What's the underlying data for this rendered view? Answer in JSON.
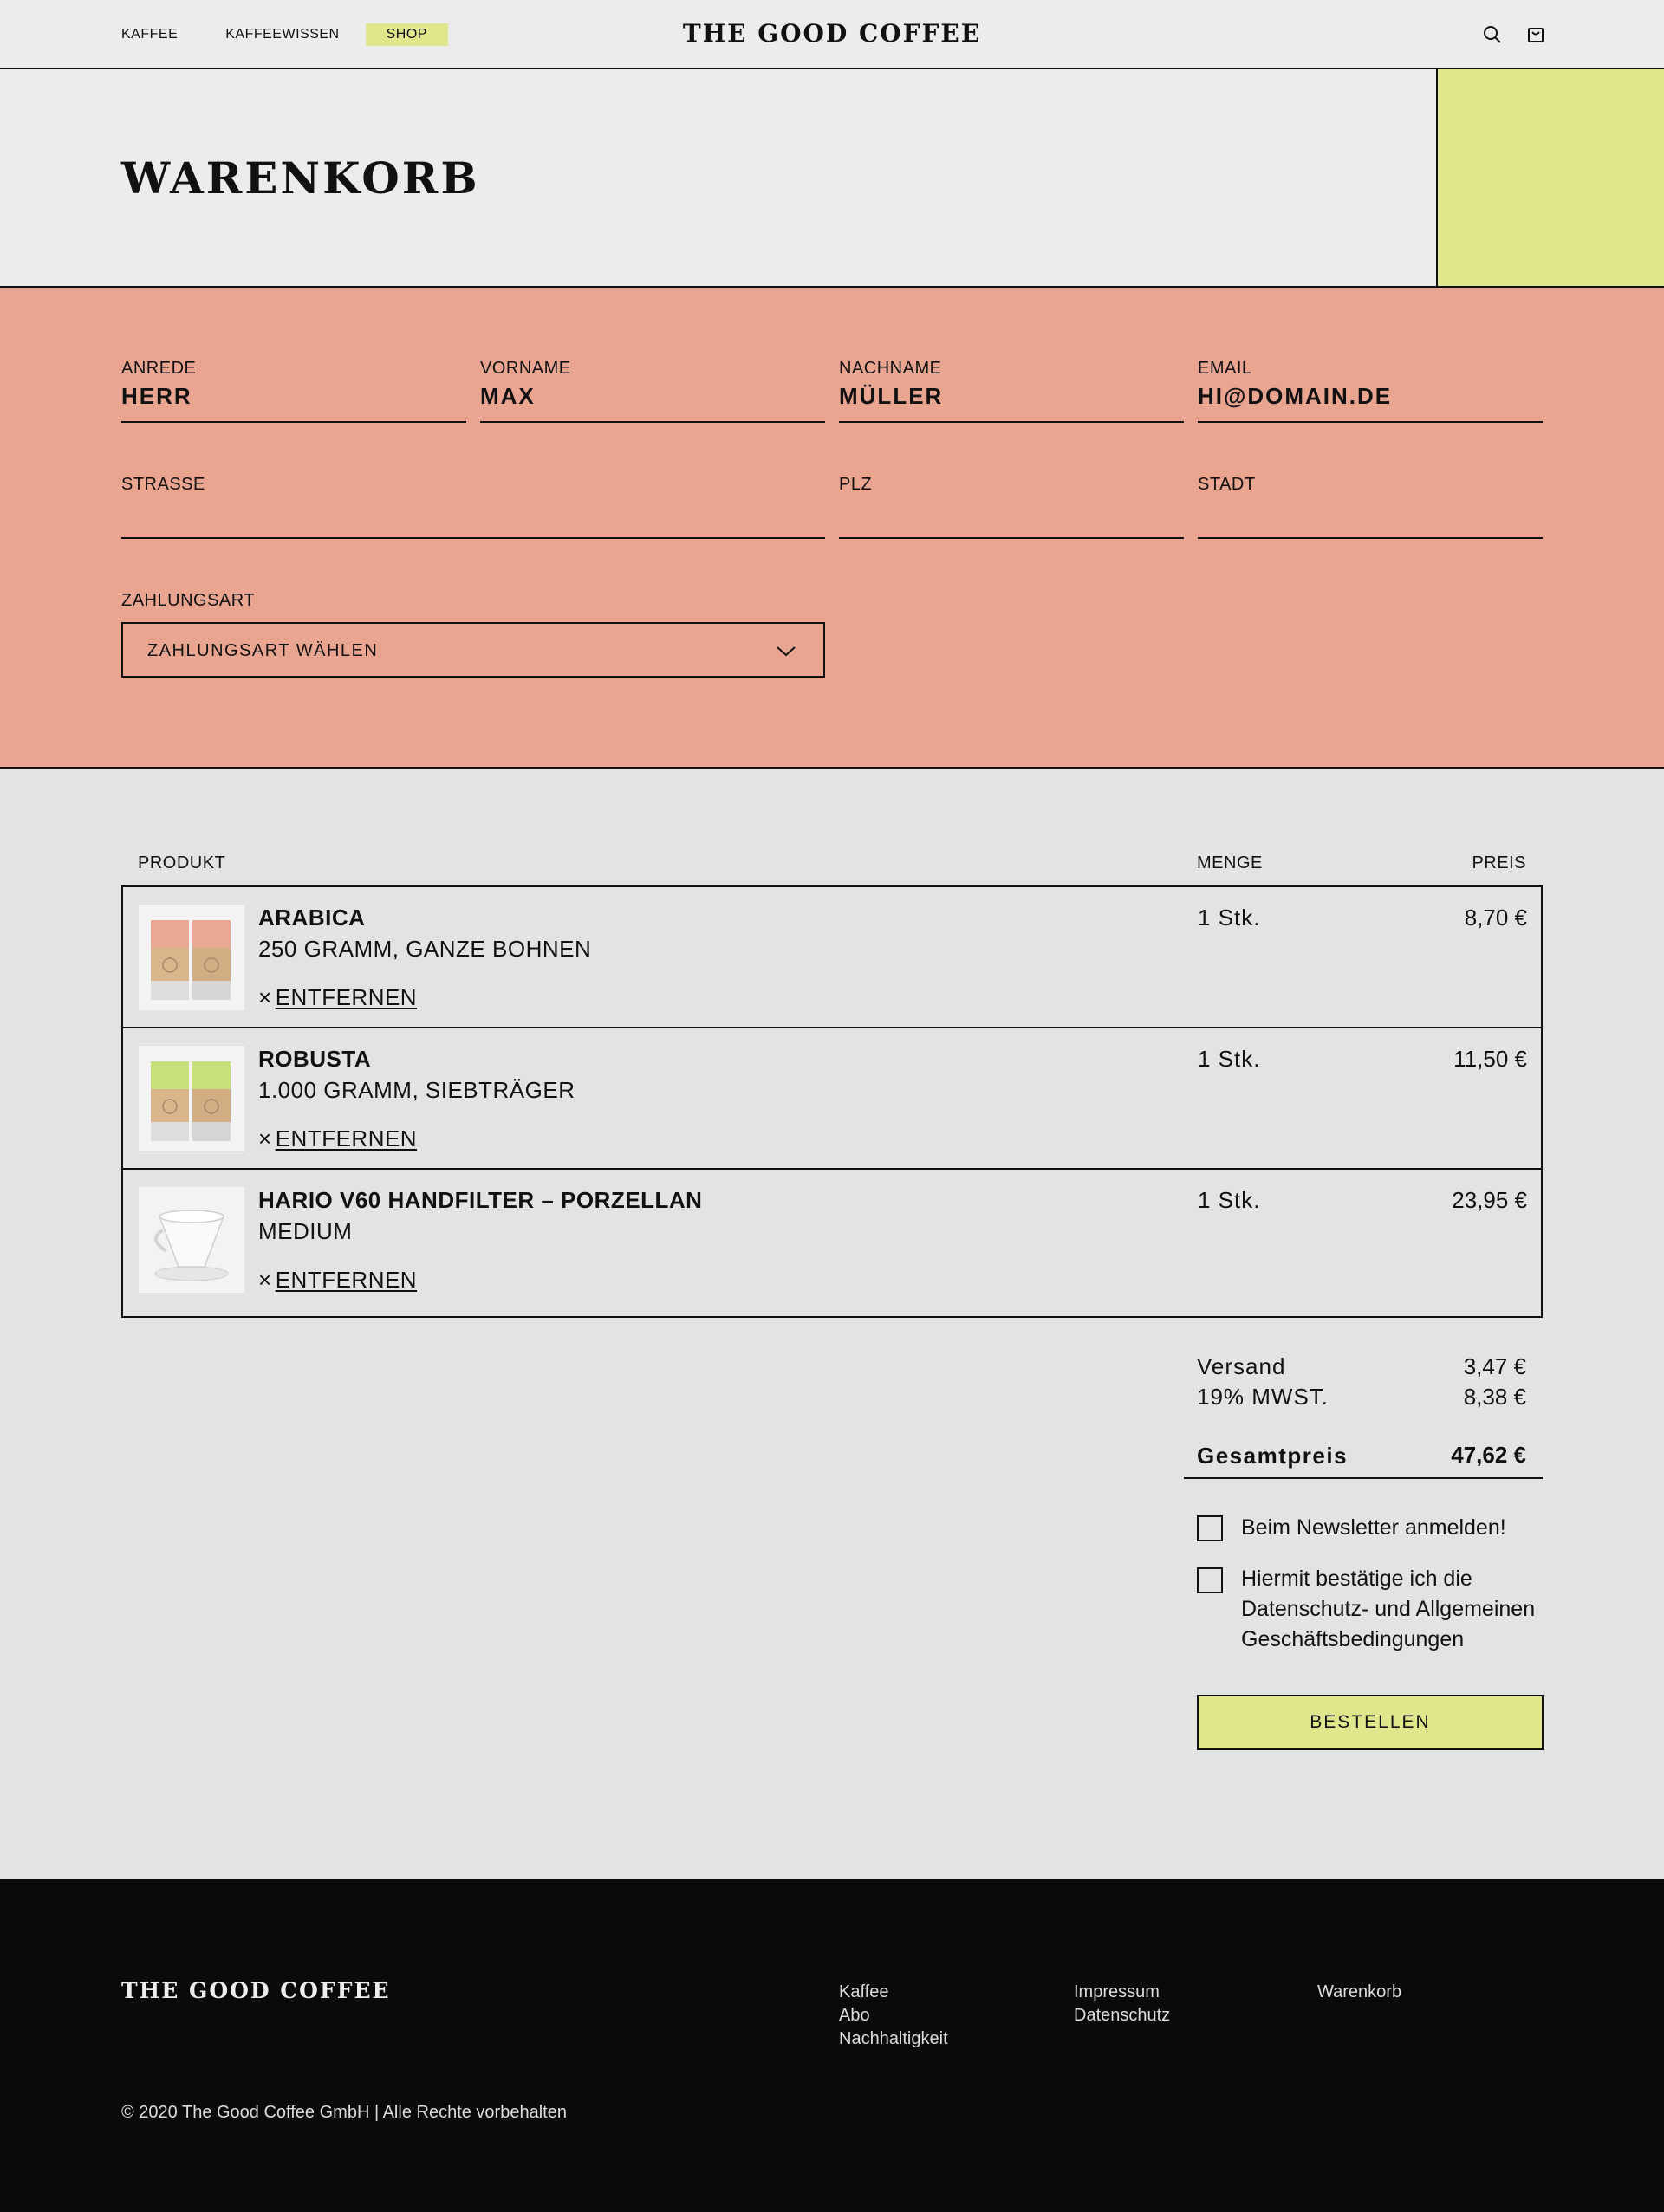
{
  "header": {
    "nav": [
      "KAFFEE",
      "KAFFEEWISSEN",
      "SHOP"
    ],
    "logo": "THE GOOD COFFEE",
    "icons": [
      "search-icon",
      "shopping-bag-icon"
    ]
  },
  "hero": {
    "title": "WARENKORB"
  },
  "form": {
    "anrede": {
      "label": "ANREDE",
      "value": "HERR"
    },
    "vorname": {
      "label": "VORNAME",
      "value": "MAX"
    },
    "nachname": {
      "label": "NACHNAME",
      "value": "MÜLLER"
    },
    "email": {
      "label": "EMAIL",
      "value": "HI@DOMAIN.DE"
    },
    "strasse": {
      "label": "STRASSE",
      "value": ""
    },
    "plz": {
      "label": "PLZ",
      "value": ""
    },
    "stadt": {
      "label": "STADT",
      "value": ""
    },
    "zahlungsart": {
      "label": "ZAHLUNGSART",
      "selected": "ZAHLUNGSART WÄHLEN"
    }
  },
  "cart": {
    "headers": {
      "product": "PRODUKT",
      "qty": "MENGE",
      "price": "PREIS"
    },
    "items": [
      {
        "name": "ARABICA",
        "variant": "250 GRAMM, GANZE BOHNEN",
        "remove_x": "×",
        "remove": "ENTFERNEN",
        "qty": "1 Stk.",
        "price": "8,70 €"
      },
      {
        "name": "ROBUSTA",
        "variant": "1.000 GRAMM, SIEBTRÄGER",
        "remove_x": "×",
        "remove": "ENTFERNEN",
        "qty": "1 Stk.",
        "price": "11,50 €"
      },
      {
        "name": "HARIO V60 HANDFILTER – PORZELLAN",
        "variant": "MEDIUM",
        "remove_x": "×",
        "remove": "ENTFERNEN",
        "qty": "1 Stk.",
        "price": "23,95 €"
      }
    ],
    "summary": {
      "shipping_label": "Versand",
      "shipping_value": "3,47 €",
      "vat_label": "19% MWST.",
      "vat_value": "8,38 €",
      "total_label": "Gesamtpreis",
      "total_value": "47,62 €"
    },
    "newsletter": "Beim Newsletter anmelden!",
    "terms": "Hiermit bestätige ich die Datenschutz- und Allgemeinen Geschäftsbedingungen",
    "order_button": "BESTELLEN"
  },
  "footer": {
    "logo": "THE GOOD COFFEE",
    "col1": [
      "Kaffee",
      "Abo",
      "Nachhaltigkeit"
    ],
    "col2": [
      "Impressum",
      "Datenschutz"
    ],
    "col3": [
      "Warenkorb"
    ],
    "copyright": "© 2020 The Good Coffee GmbH | Alle Rechte vorbehalten"
  },
  "colors": {
    "accent": "#e0e68c",
    "form_bg": "#eaa590",
    "page_bg": "#e3e3e3",
    "footer_bg": "#0a0a0a"
  }
}
